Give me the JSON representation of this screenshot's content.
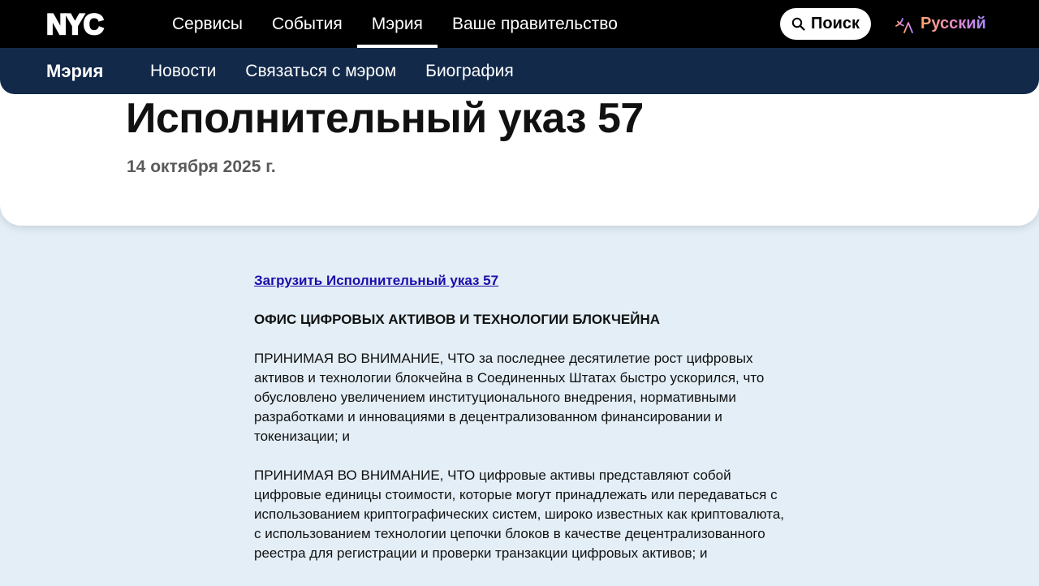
{
  "topbar": {
    "logo_text": "NYC",
    "nav": [
      {
        "label": "Сервисы"
      },
      {
        "label": "События"
      },
      {
        "label": "Мэрия",
        "active": true
      },
      {
        "label": "Ваше правительство"
      }
    ],
    "search_label": "Поиск",
    "search_icon": "search-icon",
    "language_label": "Русский",
    "language_icon": "translate-icon"
  },
  "subbar": {
    "title": "Мэрия",
    "items": [
      {
        "label": "Новости"
      },
      {
        "label": "Связаться с мэром"
      },
      {
        "label": "Биография"
      }
    ]
  },
  "header": {
    "title": "Исполнительный указ 57",
    "date": "14 октября 2025 г."
  },
  "content": {
    "download_link": "Загрузить Исполнительный указ 57",
    "heading": "ОФИС ЦИФРОВЫХ АКТИВОВ И ТЕХНОЛОГИИ БЛОКЧЕЙНА",
    "paragraphs": [
      "ПРИНИМАЯ ВО ВНИМАНИЕ, ЧТО за последнее десятилетие рост цифровых активов и технологии блокчейна в Соединенных Штатах быстро ускорился, что обусловлено увеличением институционального внедрения, нормативными разработками и инновациями в децентрализованном финансировании и токенизации; и",
      "ПРИНИМАЯ ВО ВНИМАНИЕ, ЧТО цифровые активы представляют собой цифровые единицы стоимости, которые могут принадлежать или передаваться с использованием криптографических систем, широко известных как криптовалюта, с использованием технологии цепочки блоков в качестве децентрализованного реестра для регистрации и проверки транзакции цифровых активов; и"
    ]
  },
  "colors": {
    "topbar_bg": "#000000",
    "subbar_bg": "#12294a",
    "page_bg": "#e3eef6",
    "link": "#1a0dab"
  }
}
